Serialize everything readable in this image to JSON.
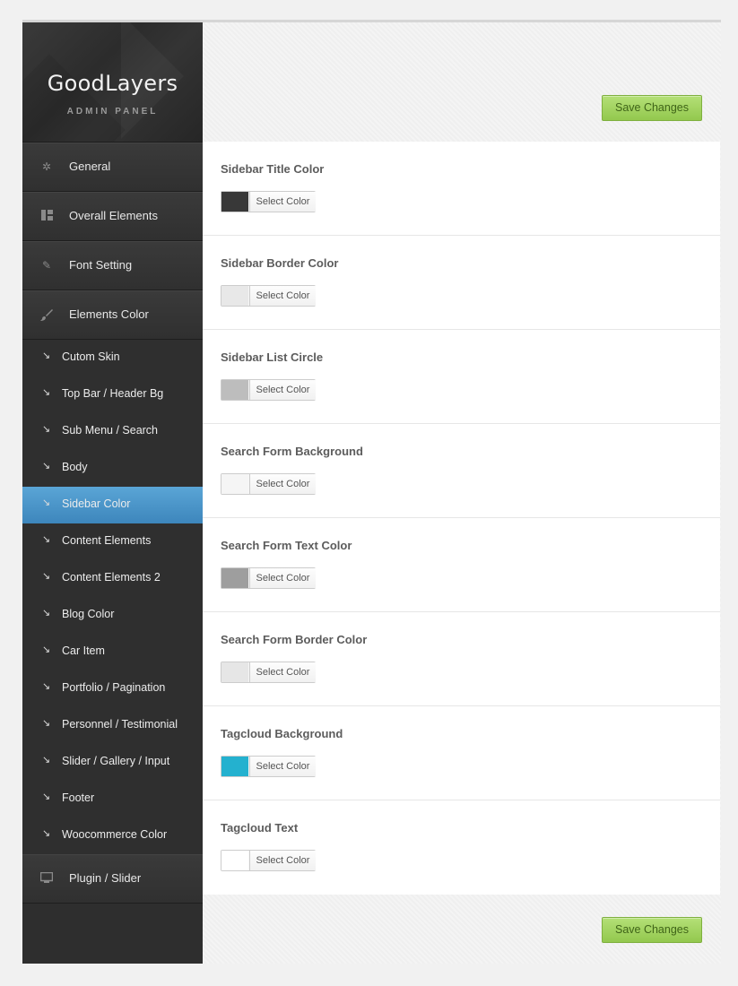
{
  "brand": {
    "title": "GoodLayers",
    "subtitle": "ADMIN PANEL"
  },
  "menu": [
    {
      "label": "General",
      "icon": "gear-icon"
    },
    {
      "label": "Overall Elements",
      "icon": "layout-icon"
    },
    {
      "label": "Font Setting",
      "icon": "pencil-icon"
    },
    {
      "label": "Elements Color",
      "icon": "brush-icon"
    }
  ],
  "submenu": [
    {
      "label": "Cutom Skin"
    },
    {
      "label": "Top Bar / Header Bg"
    },
    {
      "label": "Sub Menu / Search"
    },
    {
      "label": "Body"
    },
    {
      "label": "Sidebar Color",
      "active": true
    },
    {
      "label": "Content Elements"
    },
    {
      "label": "Content Elements 2"
    },
    {
      "label": "Blog Color"
    },
    {
      "label": "Car Item"
    },
    {
      "label": "Portfolio / Pagination"
    },
    {
      "label": "Personnel / Testimonial"
    },
    {
      "label": "Slider / Gallery / Input"
    },
    {
      "label": "Footer"
    },
    {
      "label": "Woocommerce Color"
    }
  ],
  "menu_bottom": {
    "label": "Plugin / Slider",
    "icon": "monitor-icon"
  },
  "buttons": {
    "save_top": "Save Changes",
    "save_bottom": "Save Changes"
  },
  "settings": [
    {
      "title": "Sidebar Title Color",
      "color": "#383838",
      "button": "Select Color"
    },
    {
      "title": "Sidebar Border Color",
      "color": "#e8e8e8",
      "button": "Select Color"
    },
    {
      "title": "Sidebar List Circle",
      "color": "#bdbdbd",
      "button": "Select Color"
    },
    {
      "title": "Search Form Background",
      "color": "#f5f5f5",
      "button": "Select Color"
    },
    {
      "title": "Search Form Text Color",
      "color": "#9e9e9e",
      "button": "Select Color"
    },
    {
      "title": "Search Form Border Color",
      "color": "#e6e6e6",
      "button": "Select Color"
    },
    {
      "title": "Tagcloud Background",
      "color": "#24b1cf",
      "button": "Select Color"
    },
    {
      "title": "Tagcloud Text",
      "color": "#ffffff",
      "button": "Select Color"
    }
  ],
  "colors": {
    "accent": "#4a96c9",
    "save_button": "#a6d565",
    "sidebar_bg": "#2e2e2e"
  }
}
